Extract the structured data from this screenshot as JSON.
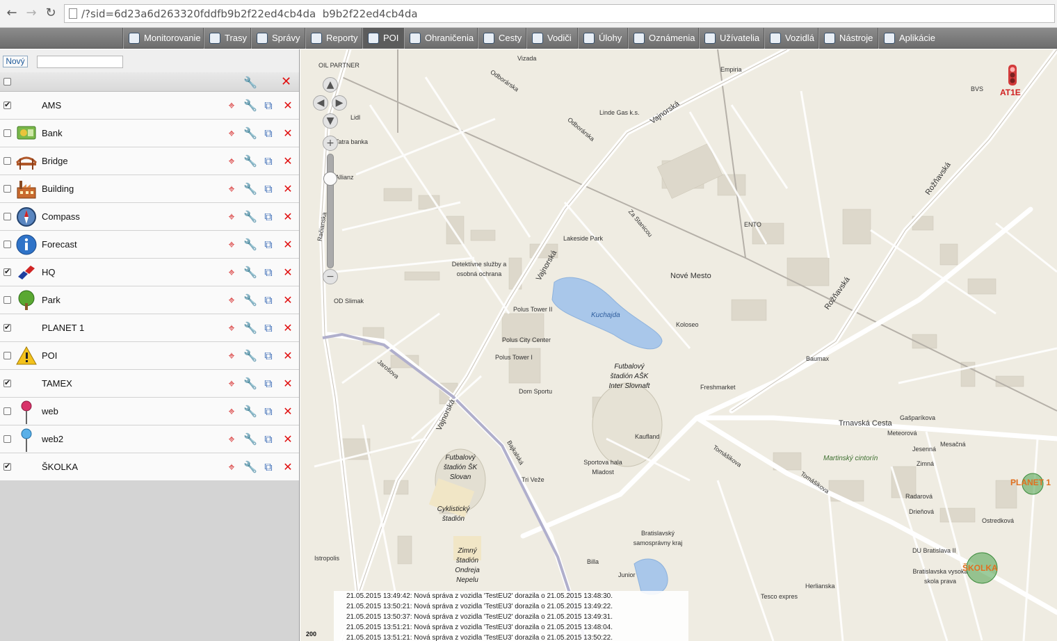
{
  "browser": {
    "url": "/?sid=6d23a6d263320fddfb9b2f22ed4cb4da  b9b2f22ed4cb4da"
  },
  "menu": {
    "items": [
      {
        "label": "Monitorovanie",
        "icon": "globe-icon"
      },
      {
        "label": "Trasy",
        "icon": "route-icon"
      },
      {
        "label": "Správy",
        "icon": "messages-icon"
      },
      {
        "label": "Reporty",
        "icon": "report-icon"
      },
      {
        "label": "POI",
        "icon": "poi-icon",
        "active": true
      },
      {
        "label": "Ohraničenia",
        "icon": "geofence-icon"
      },
      {
        "label": "Cesty",
        "icon": "roads-icon"
      },
      {
        "label": "Vodiči",
        "icon": "driver-icon"
      },
      {
        "label": "Úlohy",
        "icon": "tasks-icon"
      },
      {
        "label": "Oznámenia",
        "icon": "notification-icon"
      },
      {
        "label": "Užívatelia",
        "icon": "users-icon"
      },
      {
        "label": "Vozidlá",
        "icon": "vehicles-icon"
      },
      {
        "label": "Nástroje",
        "icon": "tools-icon"
      },
      {
        "label": "Aplikácie",
        "icon": "apps-icon"
      }
    ]
  },
  "panel": {
    "new_label": "Nový",
    "filter_value": "",
    "pois": [
      {
        "name": "AMS",
        "checked": true,
        "icon": "none"
      },
      {
        "name": "Bank",
        "checked": false,
        "icon": "money-icon"
      },
      {
        "name": "Bridge",
        "checked": false,
        "icon": "bridge-icon"
      },
      {
        "name": "Building",
        "checked": false,
        "icon": "factory-icon"
      },
      {
        "name": "Compass",
        "checked": false,
        "icon": "compass-icon"
      },
      {
        "name": "Forecast",
        "checked": false,
        "icon": "info-icon"
      },
      {
        "name": "HQ",
        "checked": true,
        "icon": "hq-logo-icon"
      },
      {
        "name": "Park",
        "checked": false,
        "icon": "tree-icon"
      },
      {
        "name": "PLANET 1",
        "checked": true,
        "icon": "none"
      },
      {
        "name": "POI",
        "checked": false,
        "icon": "warning-icon"
      },
      {
        "name": "TAMEX",
        "checked": true,
        "icon": "none"
      },
      {
        "name": "web",
        "checked": false,
        "icon": "pin-red-icon"
      },
      {
        "name": "web2",
        "checked": false,
        "icon": "pin-blue-icon"
      },
      {
        "name": "ŠKOLKA",
        "checked": true,
        "icon": "none"
      }
    ]
  },
  "map": {
    "labels": {
      "oil_partner": "OIL PARTNER",
      "lidl": "Lidl",
      "tatra_banka": "Tatra banka",
      "allianz": "Allianz",
      "vizada": "Vizada",
      "empiria": "Empiria",
      "linde_gas": "Linde Gas k.s.",
      "bvs": "BVS",
      "ento": "ENTO",
      "nove_mesto": "Nové Mesto",
      "lakeside_park": "Lakeside Park",
      "detektivne": "Detektívne služby a osobná ochrana",
      "od_slimak": "OD Slimak",
      "polus_tower_ii": "Polus Tower II",
      "polus_city_center": "Polus City Center",
      "polus_tower_i": "Polus Tower I",
      "dom_sportu": "Dom Sportu",
      "kuchajda": "Kuchajda",
      "futbal_inter": "Futbalový štadión AŠK Inter Slovnaft",
      "koloseo": "Koloseo",
      "baumax": "Baumax",
      "freshmarket": "Freshmarket",
      "kaufland": "Kaufland",
      "sportova_hala": "Sportova hala Mladost",
      "futbal_slovan": "Futbalový štadión ŠK Slovan",
      "cyklisticky": "Cyklistický štadión",
      "zimny": "Zimný štadión Ondreja Nepelu",
      "tri_veze": "Tri Veže",
      "bratislavsky_kraj": "Bratislavský samosprávny kraj",
      "billa": "Billa",
      "junior": "Junior",
      "martinsky": "Martinský cintorín",
      "du_bratislava": "DU Bratislava II",
      "vysoka_skola": "Bratislavska vysoka skola prava",
      "herlianska": "Herlianska",
      "istropolis": "Istropolis",
      "tesco": "Tesco expres",
      "trnavska_cesta": "Trnavská Cesta",
      "vajnorska": "Vajnorská",
      "roznavska": "Rožňavská",
      "bajkalska": "Bajkalská",
      "jarosova": "Jarošova",
      "odborarska": "Odborárska",
      "racianska": "Račianska",
      "za_stancou": "Za Stanicou",
      "tomasikova": "Tomášikova",
      "gasparikova": "Gašparíkova",
      "mesacna": "Mesačná",
      "zimna": "Zimná",
      "radarova": "Radarová",
      "drienova": "Drieňová",
      "ostredkova": "Ostredková",
      "meteorova": "Meteorová",
      "jesenna": "Jesenná"
    },
    "markers": {
      "at1e": "AT1E",
      "planet1": "PLANET 1",
      "skolka": "ŠKOLKA"
    },
    "scale_text": "200",
    "messages": [
      "21.05.2015 13:49:42: Nová správa z vozidla 'TestEU2' dorazila o 21.05.2015 13:48:30.",
      "21.05.2015 13:50:21: Nová správa z vozidla 'TestEU3' dorazila o 21.05.2015 13:49:22.",
      "21.05.2015 13:50:37: Nová správa z vozidla 'TestEU2' dorazila o 21.05.2015 13:49:31.",
      "21.05.2015 13:51:21: Nová správa z vozidla 'TestEU3' dorazila o 21.05.2015 13:48:04.",
      "21.05.2015 13:51:21: Nová správa z vozidla 'TestEU3' dorazila o 21.05.2015 13:50:22."
    ]
  }
}
